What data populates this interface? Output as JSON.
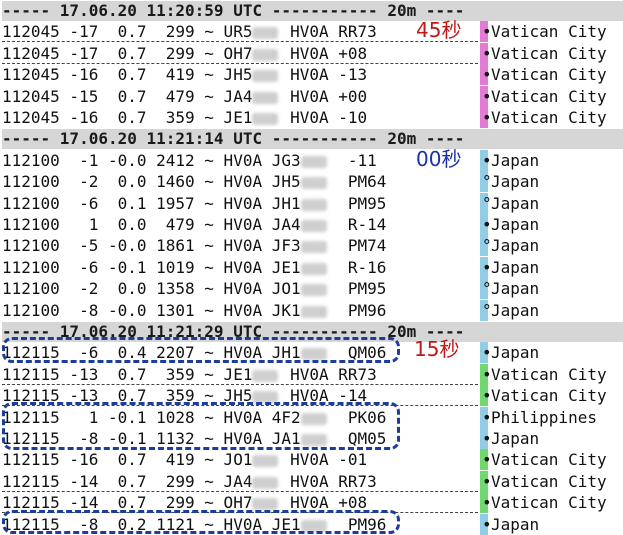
{
  "colors": {
    "sep_bg": "#d6d6d6",
    "bar_pink": "#e27ad6",
    "bar_blue": "#92cde6",
    "bar_green": "#6fd96f",
    "annot_red": "#c01818",
    "annot_blue": "#1a2fb0",
    "box_blue": "#1d3d9a"
  },
  "annotations": {
    "sec45": "45秒",
    "sec00": "00秒",
    "sec15": "15秒"
  },
  "rows": [
    {
      "kind": "sep",
      "text": "----- 17.06.20 11:20:59 UTC ----------- 20m ----"
    },
    {
      "kind": "msg",
      "pre": "112045 -17  0.7  299 ~ UR5",
      "post": " HV0A RR73",
      "marker": "•",
      "country": "Vatican City",
      "bar": "pink"
    },
    {
      "kind": "msg",
      "pre": "112045 -17  0.7  299 ~ OH7",
      "post": " HV0A +08",
      "marker": "•",
      "country": "Vatican City",
      "bar": "pink"
    },
    {
      "kind": "msg",
      "pre": "112045 -16  0.7  419 ~ JH5",
      "post": " HV0A -13",
      "marker": "•",
      "country": "Vatican City",
      "bar": "pink"
    },
    {
      "kind": "msg",
      "pre": "112045 -15  0.7  479 ~ JA4",
      "post": " HV0A +00",
      "marker": "•",
      "country": "Vatican City",
      "bar": "pink"
    },
    {
      "kind": "msg",
      "pre": "112045 -16  0.7  359 ~ JE1",
      "post": " HV0A -10",
      "marker": "•",
      "country": "Vatican City",
      "bar": "pink"
    },
    {
      "kind": "sep",
      "text": "----- 17.06.20 11:21:14 UTC ----------- 20m ----"
    },
    {
      "kind": "msg",
      "pre": "112100  -1 -0.0 2412 ~ HV0A JG3",
      "post": "  -11",
      "marker": "•",
      "country": "Japan",
      "bar": "blue"
    },
    {
      "kind": "msg",
      "pre": "112100  -2  0.0 1460 ~ HV0A JH5",
      "post": "  PM64",
      "marker": "°",
      "country": "Japan",
      "bar": "blue"
    },
    {
      "kind": "msg",
      "pre": "112100  -6  0.1 1957 ~ HV0A JH1",
      "post": "  PM95",
      "marker": "°",
      "country": "Japan",
      "bar": "blue"
    },
    {
      "kind": "msg",
      "pre": "112100   1  0.0  479 ~ HV0A JA4",
      "post": "  R-14",
      "marker": "•",
      "country": "Japan",
      "bar": "blue"
    },
    {
      "kind": "msg",
      "pre": "112100  -5 -0.0 1861 ~ HV0A JF3",
      "post": "  PM74",
      "marker": "°",
      "country": "Japan",
      "bar": "blue"
    },
    {
      "kind": "msg",
      "pre": "112100  -6 -0.1 1019 ~ HV0A JE1",
      "post": "  R-16",
      "marker": "•",
      "country": "Japan",
      "bar": "blue"
    },
    {
      "kind": "msg",
      "pre": "112100  -2  0.0 1358 ~ HV0A JO1",
      "post": "  PM95",
      "marker": "°",
      "country": "Japan",
      "bar": "blue"
    },
    {
      "kind": "msg",
      "pre": "112100  -8 -0.0 1301 ~ HV0A JK1",
      "post": "  PM96",
      "marker": "°",
      "country": "Japan",
      "bar": "blue"
    },
    {
      "kind": "sep",
      "text": "----- 17.06.20 11:21:29 UTC ----------- 20m ----"
    },
    {
      "kind": "msg",
      "pre": "112115  -6  0.4 2207 ~ HV0A JH1",
      "post": "  QM06",
      "marker": "•",
      "country": "Japan",
      "bar": "blue"
    },
    {
      "kind": "msg",
      "pre": "112115 -13  0.7  359 ~ JE1",
      "post": " HV0A RR73",
      "marker": "•",
      "country": "Vatican City",
      "bar": "green"
    },
    {
      "kind": "msg",
      "pre": "112115 -13  0.7  359 ~ JH5",
      "post": " HV0A -14",
      "marker": "•",
      "country": "Vatican City",
      "bar": "green"
    },
    {
      "kind": "msg",
      "pre": "112115   1 -0.1 1028 ~ HV0A 4F2",
      "post": "  PK06",
      "marker": "•",
      "country": "Philippines",
      "bar": "blue"
    },
    {
      "kind": "msg",
      "pre": "112115  -8 -0.1 1132 ~ HV0A JA1",
      "post": "  QM05",
      "marker": "•",
      "country": "Japan",
      "bar": "blue"
    },
    {
      "kind": "msg",
      "pre": "112115 -16  0.7  419 ~ JO1",
      "post": " HV0A -01",
      "marker": "•",
      "country": "Vatican City",
      "bar": "green"
    },
    {
      "kind": "msg",
      "pre": "112115 -14  0.7  299 ~ JA4",
      "post": " HV0A RR73",
      "marker": "•",
      "country": "Vatican City",
      "bar": "green"
    },
    {
      "kind": "msg",
      "pre": "112115 -14  0.7  299 ~ OH7",
      "post": " HV0A +08",
      "marker": "•",
      "country": "Vatican City",
      "bar": "green"
    },
    {
      "kind": "msg",
      "pre": "112115  -8  0.2 1121 ~ HV0A JE1",
      "post": "  PM96",
      "marker": "•",
      "country": "Japan",
      "bar": "blue"
    }
  ]
}
